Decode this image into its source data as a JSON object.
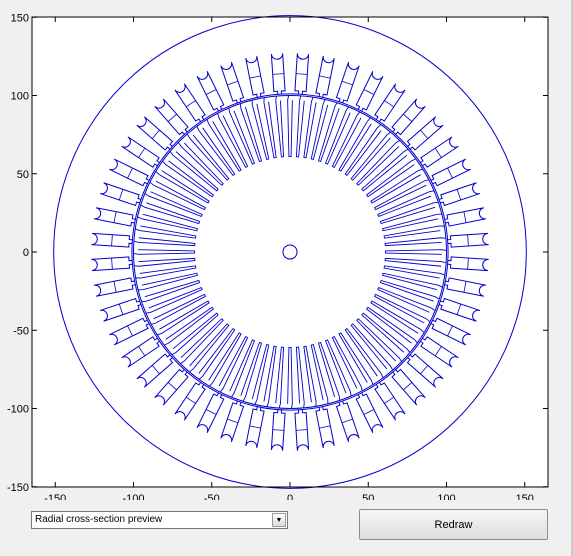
{
  "figure": {
    "plot_type": "motor cross-section outline",
    "xlim": [
      -165,
      165
    ],
    "ylim": [
      -150,
      150
    ],
    "xticks": [
      "-150",
      "-100",
      "-50",
      "0",
      "50",
      "100",
      "150"
    ],
    "yticks": [
      "150",
      "100",
      "50",
      "0",
      "-50",
      "-100",
      "-150"
    ],
    "line_color": "#0000cc",
    "axes_color": "#000000",
    "background": "#ffffff",
    "stator_outer_radius": 151,
    "stator_inner_radius": 101,
    "stator_slots": 48,
    "rotor_outer_radius": 100,
    "rotor_slot_bottom_radius": 61,
    "rotor_slots": 80,
    "shaft_hole_radius": 4.5
  },
  "controls": {
    "view_select": {
      "value": "Radial cross-section preview",
      "arrow_icon": "triangle-down"
    },
    "redraw_label": "Redraw"
  }
}
